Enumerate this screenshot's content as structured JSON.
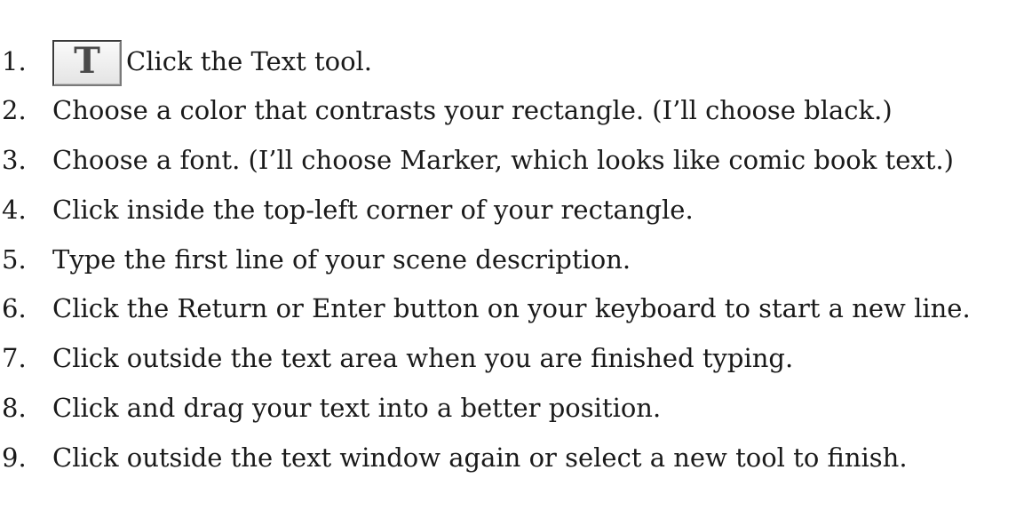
{
  "tool_button": {
    "icon": "text-tool-icon",
    "glyph": "T"
  },
  "steps": [
    {
      "number": "1.",
      "text": "Click the Text tool."
    },
    {
      "number": "2.",
      "text": "Choose a color that contrasts your rectangle. (I’ll choose black.)"
    },
    {
      "number": "3.",
      "text": "Choose a font. (I’ll choose Marker, which looks like comic book text.)"
    },
    {
      "number": "4.",
      "text": "Click inside the top-left corner of your rectangle."
    },
    {
      "number": "5.",
      "text": "Type the first line of your scene description."
    },
    {
      "number": "6.",
      "text": "Click the Return or Enter button on your keyboard to start a new line."
    },
    {
      "number": "7.",
      "text": "Click outside the text area when you are finished typing."
    },
    {
      "number": "8.",
      "text": "Click and drag your text into a better position."
    },
    {
      "number": "9.",
      "text": "Click outside the text window again or select a new tool to finish."
    }
  ]
}
